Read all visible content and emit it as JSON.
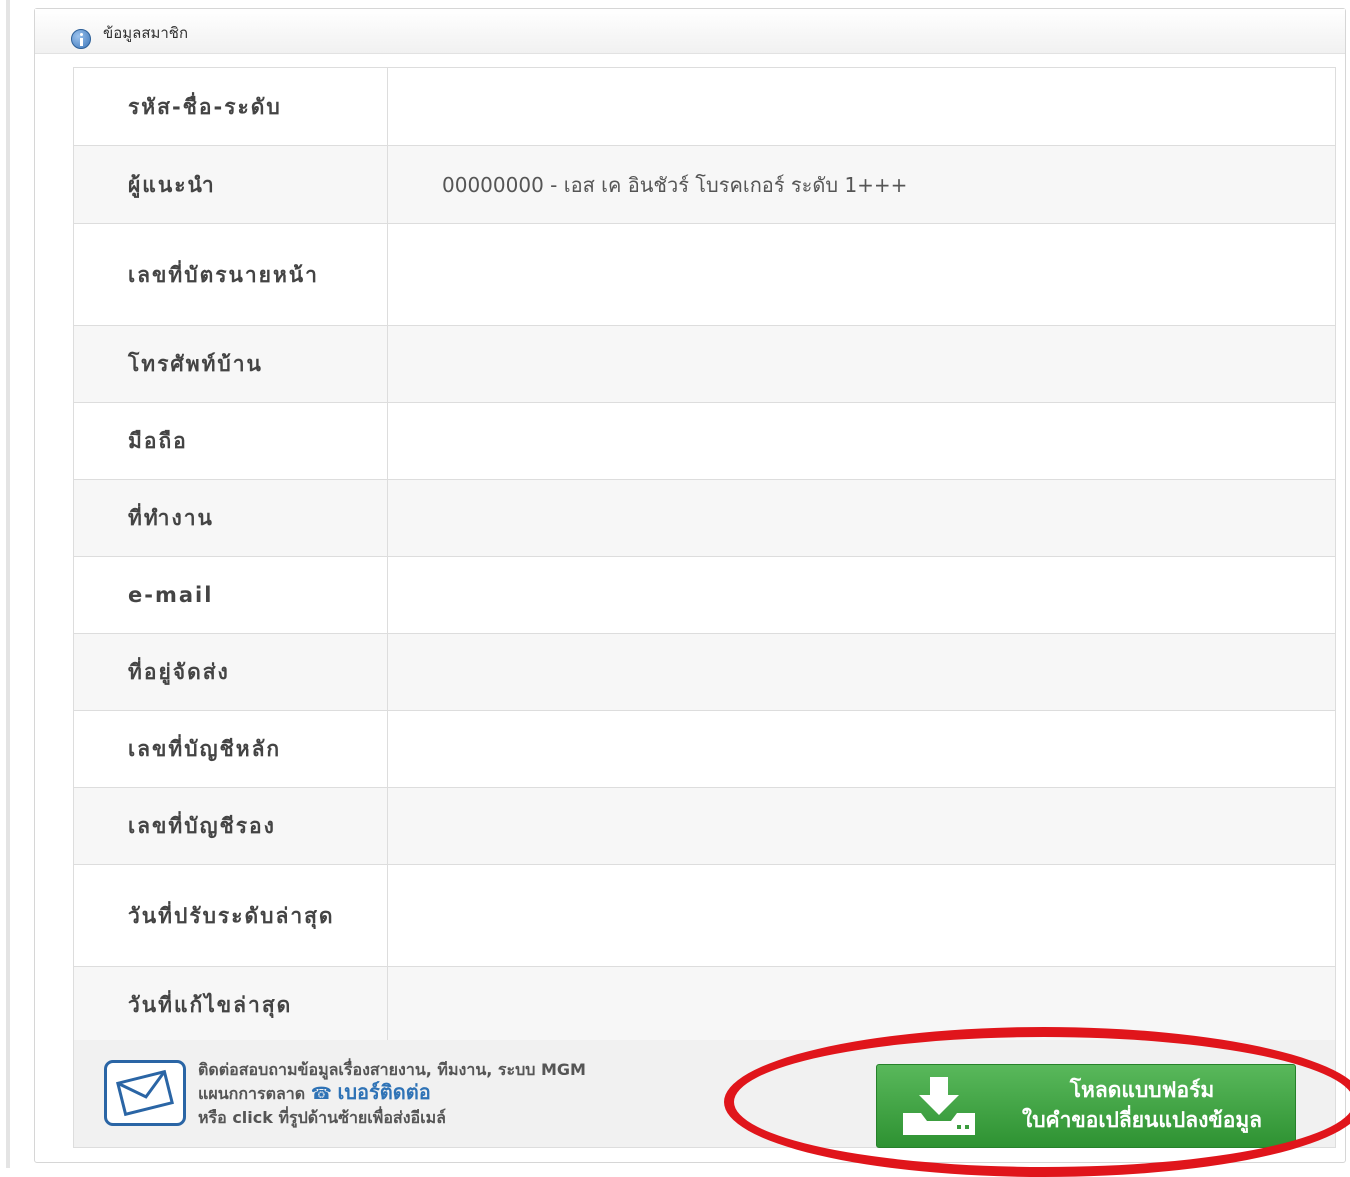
{
  "panel": {
    "title": "ข้อมูลสมาชิก",
    "icon": "info-icon"
  },
  "rows": [
    {
      "label": "รหัส-ชื่อ-ระดับ",
      "value": ""
    },
    {
      "label": "ผู้แนะนำ",
      "value": "00000000 - เอส เค อินชัวร์ โบรคเกอร์ ระดับ 1+++"
    },
    {
      "label": "เลขที่บัตรนายหน้า",
      "value": ""
    },
    {
      "label": "โทรศัพท์บ้าน",
      "value": ""
    },
    {
      "label": "มือถือ",
      "value": ""
    },
    {
      "label": "ที่ทำงาน",
      "value": ""
    },
    {
      "label": "e-mail",
      "value": ""
    },
    {
      "label": "ที่อยู่จัดส่ง",
      "value": ""
    },
    {
      "label": "เลขที่บัญชีหลัก",
      "value": ""
    },
    {
      "label": "เลขที่บัญชีรอง",
      "value": ""
    },
    {
      "label": "วันที่ปรับระดับล่าสุด",
      "value": ""
    },
    {
      "label": "วันที่แก้ไขล่าสุด",
      "value": ""
    }
  ],
  "footer": {
    "line1": "ติดต่อสอบถามข้อมูลเรื่องสายงาน, ทีมงาน, ระบบ MGM",
    "line2_prefix": "แผนกการตลาด",
    "contact_link": "เบอร์ติดต่อ",
    "line3": "หรือ click ที่รูปด้านซ้ายเพื่อส่งอีเมล์",
    "download_button": {
      "line1": "โหลดแบบฟอร์ม",
      "line2": "ใบคำขอเปลี่ยนแปลงข้อมูล"
    }
  },
  "colors": {
    "button_green": "#3a9c3d",
    "link_blue": "#2f73b6",
    "highlight_red": "#e0151b",
    "icon_blue": "#2a65a5"
  }
}
